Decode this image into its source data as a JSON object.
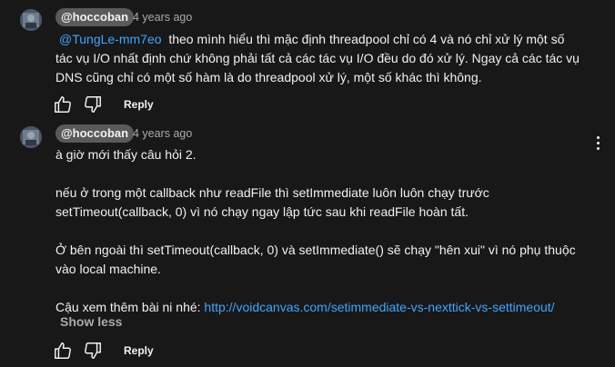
{
  "comments": [
    {
      "author": "@hoccoban",
      "time": "4 years ago",
      "mention": "@TungLe-mm7eo",
      "lines": [
        "theo mình hiểu thì mặc định threadpool chỉ có 4 và nó chỉ xử lý một số",
        "tác vụ I/O nhất định chứ không phải tất cả các tác vụ I/O đều do đó xử lý. Ngay cả các tác vụ",
        "DNS cũng chỉ có một số hàm là do threadpool xử lý, một số khác thì không."
      ],
      "reply_label": "Reply",
      "icons": {
        "like": "thumb-up-icon",
        "dislike": "thumb-down-icon"
      }
    },
    {
      "author": "@hoccoban",
      "time": "4 years ago",
      "lines": [
        "à giờ mới thấy câu hỏi 2.",
        "nếu ở trong một callback như readFile thì setImmediate luôn luôn chạy trước",
        "setTimeout(callback, 0) vì nó chạy ngay lập tức sau khi readFile hoàn tất.",
        "Ở bên ngoài thì setTimeout(callback, 0) và setImmediate() sẽ chạy \"hên xui\" vì nó phụ thuộc",
        "vào local machine.",
        "Cậu xem thêm bài ni nhé:"
      ],
      "link": "http://voidcanvas.com/setimmediate-vs-nexttick-vs-settimeout/",
      "show_less_label": "Show less",
      "reply_label": "Reply",
      "icons": {
        "like": "thumb-up-icon",
        "dislike": "thumb-down-icon",
        "menu": "more-vert-icon"
      }
    }
  ],
  "colors": {
    "background": "#181818",
    "text": "#f1f1f1",
    "secondary_text": "#aaaaaa",
    "link": "#3ea6ff",
    "author_chip": "#5a5a5a"
  }
}
